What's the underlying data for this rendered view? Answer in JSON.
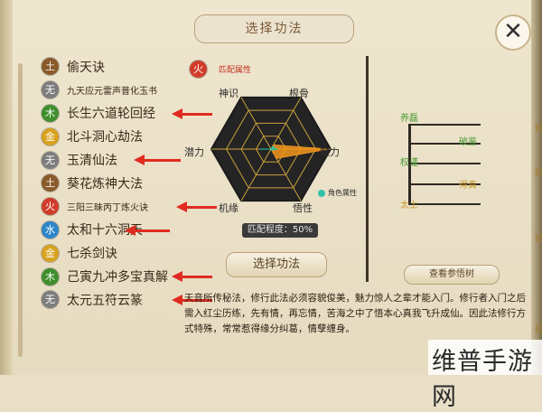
{
  "title": "选择功法",
  "close_glyph": "✕",
  "skills": [
    {
      "element": "土",
      "name": "偷天诀",
      "color": "#8a5a2b",
      "arrow": false,
      "small": false
    },
    {
      "element": "无",
      "name": "九天应元雷声普化玉书",
      "color": "#7d7d7d",
      "arrow": false,
      "small": true
    },
    {
      "element": "木",
      "name": "长生六道轮回经",
      "color": "#3f8f2d",
      "arrow": true,
      "small": false
    },
    {
      "element": "金",
      "name": "北斗洞心劫法",
      "color": "#d9a21e",
      "arrow": false,
      "small": false
    },
    {
      "element": "无",
      "name": "玉清仙法",
      "color": "#7d7d7d",
      "arrow": true,
      "small": false
    },
    {
      "element": "土",
      "name": "葵花炼神大法",
      "color": "#8a5a2b",
      "arrow": false,
      "small": false
    },
    {
      "element": "火",
      "name": "三阳三昧丙丁炼火诀",
      "color": "#d13c2a",
      "arrow": true,
      "small": true
    },
    {
      "element": "水",
      "name": "太和十六洞天",
      "color": "#2f86c9",
      "arrow": true,
      "small": false
    },
    {
      "element": "金",
      "name": "七杀剑诀",
      "color": "#d9a21e",
      "arrow": false,
      "small": false
    },
    {
      "element": "木",
      "name": "己寅九冲多宝真解",
      "color": "#3f8f2d",
      "arrow": true,
      "small": false
    },
    {
      "element": "无",
      "name": "太元五符云篆",
      "color": "#7d7d7d",
      "arrow": true,
      "small": false
    }
  ],
  "attr": {
    "element": "火",
    "element_color": "#d13c2a",
    "label": "匹配属性",
    "role_label": "角色属性"
  },
  "stats": [
    "神识",
    "根骨",
    "魅力",
    "悟性",
    "机缘",
    "潜力"
  ],
  "chart_data": {
    "type": "radar",
    "axes": [
      "神识",
      "根骨",
      "魅力",
      "悟性",
      "机缘",
      "潜力"
    ],
    "max": 100,
    "series": [
      {
        "name": "匹配属性",
        "color": "#f2961c",
        "values": [
          0,
          8,
          96,
          18,
          0,
          28
        ]
      },
      {
        "name": "角色属性",
        "color": "#2fc2a8",
        "values": [
          0,
          5,
          10,
          2,
          0,
          20
        ]
      }
    ]
  },
  "match_text": "匹配程度：50%",
  "select_button": "选择功法",
  "view_tree_button": "查看参悟树",
  "tree": [
    {
      "text": "养磊",
      "color": "#4a9a32"
    },
    {
      "text": "破鉴",
      "color": "#4a9a32"
    },
    {
      "text": "权谨",
      "color": "#4a9a32"
    },
    {
      "text": "得真",
      "color": "#c99a2a"
    },
    {
      "text": "太上",
      "color": "#c99a2a"
    }
  ],
  "right_edge": [
    "仙",
    "仙",
    "仙",
    "仙"
  ],
  "description": "天音所传秘法，修行此法必须容貌俊美，魅力惊人之辈才能入门。修行者入门之后需入红尘历练，先有情，再忘情，苦海之中了悟本心真我飞升成仙。因此法修行方式特殊，常常惹得缘分纠葛，情孽缠身。",
  "watermark": "维普手游网"
}
